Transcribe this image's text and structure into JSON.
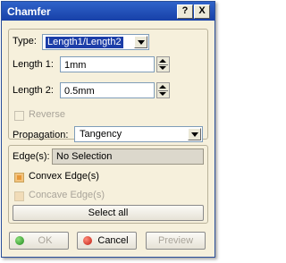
{
  "window": {
    "title": "Chamfer"
  },
  "titlebar_buttons": {
    "help": "?",
    "close": "X"
  },
  "form": {
    "type_label": "Type:",
    "type_value": "Length1/Length2",
    "length1_label": "Length 1:",
    "length1_value": "1mm",
    "length2_label": "Length 2:",
    "length2_value": "0.5mm",
    "reverse_label": "Reverse",
    "propagation_label": "Propagation:",
    "propagation_value": "Tangency"
  },
  "edges": {
    "label": "Edge(s):",
    "value": "No Selection",
    "convex_label": "Convex Edge(s)",
    "concave_label": "Concave Edge(s)",
    "select_all": "Select all"
  },
  "buttons": {
    "ok": "OK",
    "cancel": "Cancel",
    "preview": "Preview"
  },
  "colors": {
    "title_bar": "#1740a8",
    "panel_bg": "#f6f0dc",
    "selection": "#1c3ea8"
  }
}
